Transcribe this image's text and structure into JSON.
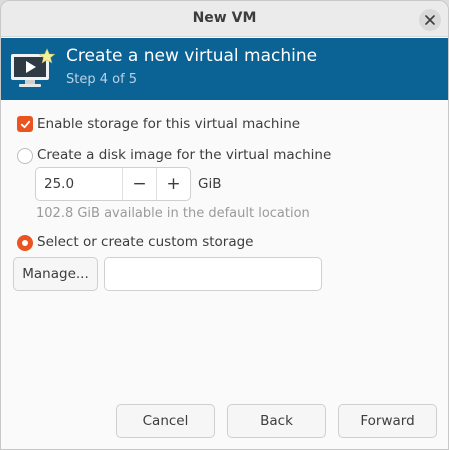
{
  "window": {
    "title": "New VM"
  },
  "banner": {
    "title": "Create a new virtual machine",
    "step": "Step 4 of 5"
  },
  "storage": {
    "enable_label": "Enable storage for this virtual machine",
    "enable_checked": true,
    "disk_image_label": "Create a disk image for the virtual machine",
    "disk_size": "25.0",
    "minus": "−",
    "plus": "+",
    "unit": "GiB",
    "available_hint": "102.8 GiB available in the default location",
    "custom_label": "Select or create custom storage",
    "selected_option": "custom",
    "manage_label": "Manage...",
    "custom_path": ""
  },
  "footer": {
    "cancel": "Cancel",
    "back": "Back",
    "forward": "Forward"
  },
  "colors": {
    "banner": "#0a6295",
    "accent": "#e95420"
  }
}
